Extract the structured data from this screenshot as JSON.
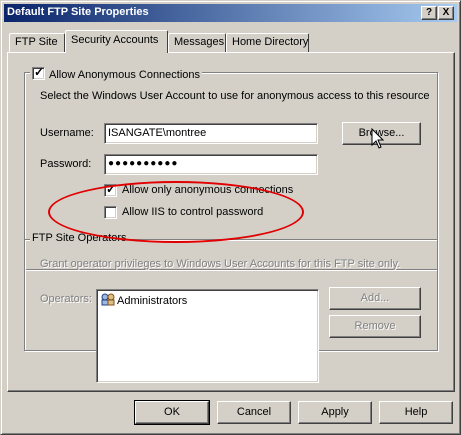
{
  "window": {
    "title": "Default FTP Site Properties",
    "help_button": "?",
    "close_button": "X"
  },
  "tabs": [
    {
      "label": "FTP Site",
      "active": false
    },
    {
      "label": "Security Accounts",
      "active": true
    },
    {
      "label": "Messages",
      "active": false
    },
    {
      "label": "Home Directory",
      "active": false
    }
  ],
  "anonymous": {
    "group_label": "Allow Anonymous Connections",
    "allow_checked": true,
    "description": "Select the Windows User Account to use for anonymous access to this resource",
    "username_label": "Username:",
    "username_value": "ISANGATE\\montree",
    "browse_label": "Browse...",
    "password_label": "Password:",
    "password_value": "●●●●●●●●●●",
    "only_anon_label": "Allow only anonymous connections",
    "only_anon_checked": true,
    "iis_pwd_label": "Allow IIS to control password",
    "iis_pwd_checked": false
  },
  "operators": {
    "group_label": "FTP Site Operators",
    "description": "Grant operator privileges to Windows User Accounts for this FTP site only.",
    "list_label": "Operators:",
    "items": [
      "Administrators"
    ],
    "add_label": "Add...",
    "remove_label": "Remove"
  },
  "footer": {
    "ok_label": "OK",
    "cancel_label": "Cancel",
    "apply_label": "Apply",
    "help_label": "Help"
  },
  "colors": {
    "title_start": "#0a246a",
    "title_end": "#a6caf0",
    "face": "#d4d0c8",
    "annotation": "#e00000"
  }
}
